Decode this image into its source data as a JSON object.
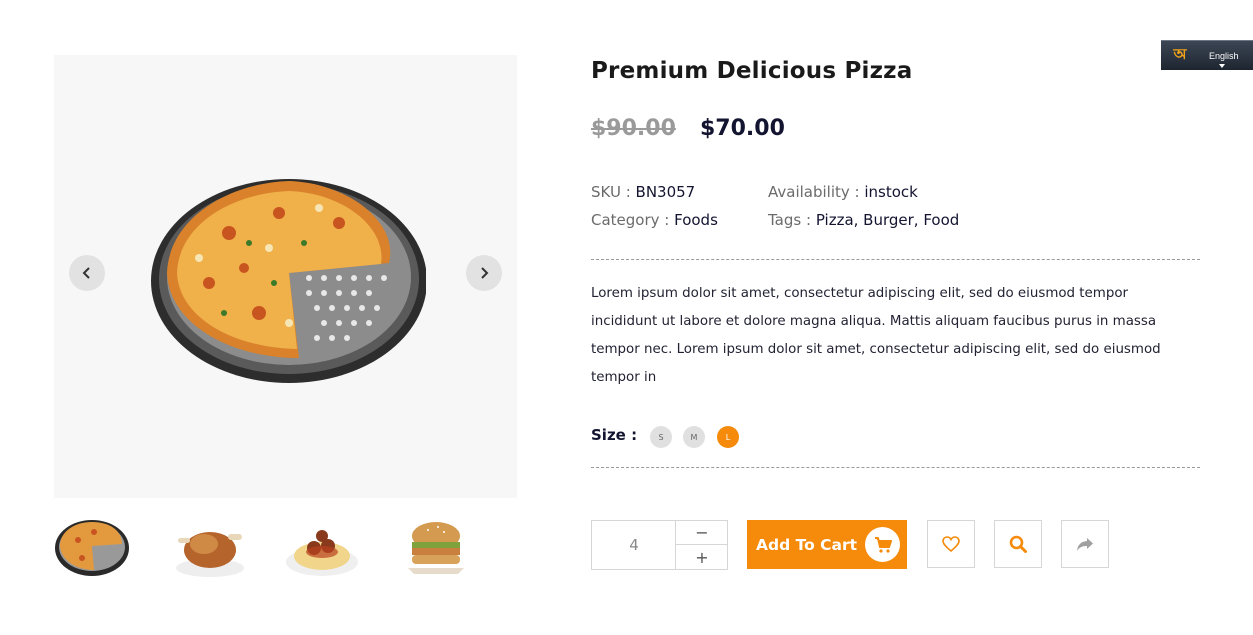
{
  "language": {
    "glyph": "অ",
    "label": "English"
  },
  "product": {
    "title": "Premium Delicious Pizza",
    "old_price": "$90.00",
    "new_price": "$70.00",
    "sku_label": "SKU : ",
    "sku": "BN3057",
    "availability_label": "Availability : ",
    "availability": "instock",
    "category_label": "Category : ",
    "category": "Foods",
    "tags_label": "Tags : ",
    "tags": "Pizza, Burger, Food",
    "description": "Lorem ipsum dolor sit amet, consectetur adipiscing elit, sed do eiusmod tempor incididunt ut labore et dolore magna aliqua. Mattis aliquam faucibus purus in massa tempor nec. Lorem ipsum dolor sit amet, consectetur adipiscing elit, sed do eiusmod tempor in",
    "size_label": "Size :",
    "sizes": [
      "S",
      "M",
      "L"
    ],
    "selected_size": "L"
  },
  "gallery": {
    "main_image": "pizza-on-pan",
    "thumbnails": [
      "pizza",
      "roast-chicken",
      "spaghetti-meatballs",
      "burger"
    ],
    "prev_icon": "chevron-left-icon",
    "next_icon": "chevron-right-icon"
  },
  "cart": {
    "quantity": "4",
    "minus": "−",
    "plus": "+",
    "add_label": "Add To Cart",
    "cart_icon": "cart-icon"
  },
  "actions": [
    "heart-icon",
    "search-icon",
    "share-icon"
  ],
  "colors": {
    "accent": "#f58a0b",
    "price": "#121430",
    "old_price": "#9a9a9a",
    "image_bg": "#f7f7f7"
  }
}
